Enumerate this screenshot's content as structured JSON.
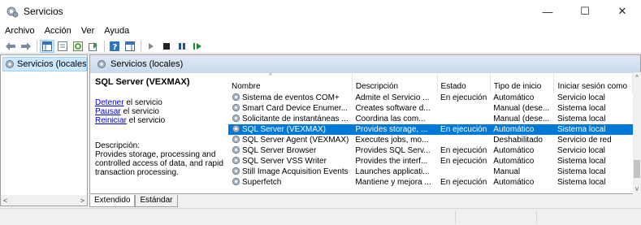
{
  "window": {
    "title": "Servicios",
    "controls": {
      "minimize": "—",
      "maximize": "☐",
      "close": "✕"
    }
  },
  "menu": [
    "Archivo",
    "Acción",
    "Ver",
    "Ayuda"
  ],
  "tree": {
    "selected_label": "Servicios (locales)"
  },
  "pane": {
    "header": "Servicios (locales)",
    "service_name": "SQL Server (VEXMAX)",
    "actions": [
      {
        "link": "Detener",
        "rest": " el servicio"
      },
      {
        "link": "Pausar",
        "rest": " el servicio"
      },
      {
        "link": "Reiniciar",
        "rest": " el servicio"
      }
    ],
    "description_label": "Descripción:",
    "description_text": "Provides storage, processing and controlled access of data, and rapid transaction processing."
  },
  "table": {
    "columns": [
      "Nombre",
      "Descripción",
      "Estado",
      "Tipo de inicio",
      "Iniciar sesión como"
    ],
    "rows": [
      [
        "Sistema de eventos COM+",
        "Admite el Servicio ...",
        "En ejecución",
        "Automático",
        "Servicio local"
      ],
      [
        "Smart Card Device Enumer...",
        "Creates software d...",
        "",
        "Manual (dese...",
        "Sistema local"
      ],
      [
        "Solicitante de instantáneas ...",
        "Coordina las com...",
        "",
        "Manual (dese...",
        "Sistema local"
      ],
      [
        "SQL Server (VEXMAX)",
        "Provides storage, ...",
        "En ejecución",
        "Automático",
        "Sistema local"
      ],
      [
        "SQL Server Agent (VEXMAX)",
        "Executes jobs, mo...",
        "",
        "Deshabilitado",
        "Servicio de red"
      ],
      [
        "SQL Server Browser",
        "Provides SQL Serv...",
        "En ejecución",
        "Automático",
        "Servicio local"
      ],
      [
        "SQL Server VSS Writer",
        "Provides the interf...",
        "En ejecución",
        "Automático",
        "Sistema local"
      ],
      [
        "Still Image Acquisition Events",
        "Launches applicati...",
        "",
        "Manual",
        "Sistema local"
      ],
      [
        "Superfetch",
        "Mantiene y mejora ...",
        "En ejecución",
        "Automático",
        "Sistema local"
      ]
    ],
    "selected_index": 3
  },
  "tabs": [
    "Extendido",
    "Estándar"
  ],
  "colors": {
    "selection": "#0078d7",
    "link": "#0000ee",
    "header_gradient": "#c9d9ec"
  }
}
